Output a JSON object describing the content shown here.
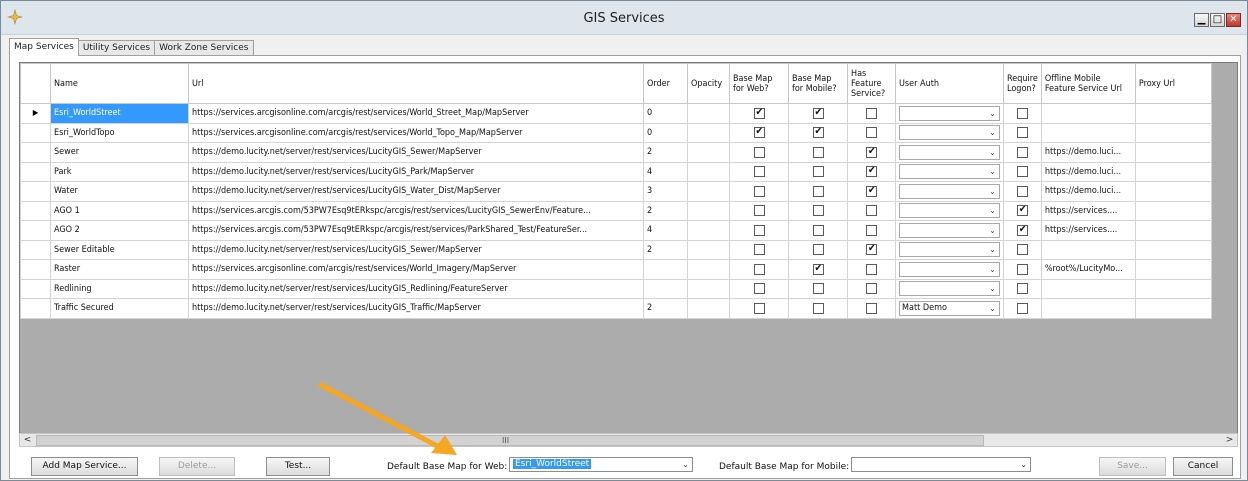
{
  "window": {
    "title": "GIS Services"
  },
  "tabs": [
    {
      "label": "Map Services",
      "active": true
    },
    {
      "label": "Utility Services",
      "active": false
    },
    {
      "label": "Work Zone Services",
      "active": false
    }
  ],
  "grid": {
    "columns": {
      "name": "Name",
      "url": "Url",
      "order": "Order",
      "opacity": "Opacity",
      "base_web": "Base Map for Web?",
      "base_mobile": "Base Map for Mobile?",
      "has_feature": "Has Feature Service?",
      "user_auth": "User Auth",
      "require_logon": "Require Logon?",
      "offline_url": "Offline Mobile Feature Service Url",
      "proxy_url": "Proxy Url"
    },
    "rows": [
      {
        "name": "Esri_WorldStreet",
        "url": "https://services.arcgisonline.com/arcgis/rest/services/World_Street_Map/MapServer",
        "order": "0",
        "web": true,
        "mobile": true,
        "feature": false,
        "auth": "",
        "logon": false,
        "offline": "",
        "selected": true
      },
      {
        "name": "Esri_WorldTopo",
        "url": "https://services.arcgisonline.com/arcgis/rest/services/World_Topo_Map/MapServer",
        "order": "0",
        "web": true,
        "mobile": true,
        "feature": false,
        "auth": "",
        "logon": false,
        "offline": ""
      },
      {
        "name": "Sewer",
        "url": "https://demo.lucity.net/server/rest/services/LucityGIS_Sewer/MapServer",
        "order": "2",
        "web": false,
        "mobile": false,
        "feature": true,
        "auth": "",
        "logon": false,
        "offline": "https://demo.luci..."
      },
      {
        "name": "Park",
        "url": "https://demo.lucity.net/server/rest/services/LucityGIS_Park/MapServer",
        "order": "4",
        "web": false,
        "mobile": false,
        "feature": true,
        "auth": "",
        "logon": false,
        "offline": "https://demo.luci..."
      },
      {
        "name": "Water",
        "url": "https://demo.lucity.net/server/rest/services/LucityGIS_Water_Dist/MapServer",
        "order": "3",
        "web": false,
        "mobile": false,
        "feature": true,
        "auth": "",
        "logon": false,
        "offline": "https://demo.luci..."
      },
      {
        "name": "AGO 1",
        "url": "https://services.arcgis.com/53PW7Esq9tERkspc/arcgis/rest/services/LucityGIS_SewerEnv/Feature...",
        "order": "2",
        "web": false,
        "mobile": false,
        "feature": false,
        "auth": "",
        "logon": true,
        "offline": "https://services...."
      },
      {
        "name": "AGO 2",
        "url": "https://services.arcgis.com/53PW7Esq9tERkspc/arcgis/rest/services/ParkShared_Test/FeatureSer...",
        "order": "4",
        "web": false,
        "mobile": false,
        "feature": false,
        "auth": "",
        "logon": true,
        "offline": "https://services...."
      },
      {
        "name": "Sewer Editable",
        "url": "https://demo.lucity.net/server/rest/services/LucityGIS_Sewer/MapServer",
        "order": "2",
        "web": false,
        "mobile": false,
        "feature": true,
        "auth": "",
        "logon": false,
        "offline": ""
      },
      {
        "name": "Raster",
        "url": "https://services.arcgisonline.com/arcgis/rest/services/World_Imagery/MapServer",
        "order": "",
        "web": false,
        "mobile": true,
        "feature": false,
        "auth": "",
        "logon": false,
        "offline": "%root%/LucityMo..."
      },
      {
        "name": "Redlining",
        "url": "https://demo.lucity.net/server/rest/services/LucityGIS_Redlining/FeatureServer",
        "order": "",
        "web": false,
        "mobile": false,
        "feature": false,
        "auth": "",
        "logon": false,
        "offline": ""
      },
      {
        "name": "Traffic Secured",
        "url": "https://demo.lucity.net/server/rest/services/LucityGIS_Traffic/MapServer",
        "order": "2",
        "web": false,
        "mobile": false,
        "feature": false,
        "auth": "Matt Demo",
        "logon": false,
        "offline": ""
      }
    ]
  },
  "scroll": {
    "left_arrow": "<",
    "right_arrow": ">",
    "grip": "III"
  },
  "bottom": {
    "add": "Add Map Service...",
    "delete": "Delete...",
    "test": "Test...",
    "web_label": "Default Base Map for Web:",
    "web_value": "Esri_WorldStreet",
    "mobile_label": "Default Base Map for Mobile:",
    "mobile_value": "",
    "save": "Save...",
    "cancel": "Cancel"
  },
  "colors": {
    "selection": "#3399ff",
    "annotation_arrow": "#f5a623"
  },
  "icons": [
    "app-icon",
    "minimize-icon",
    "restore-icon",
    "close-icon",
    "row-pointer-icon",
    "dropdown-arrow-icon",
    "annotation-arrow"
  ]
}
